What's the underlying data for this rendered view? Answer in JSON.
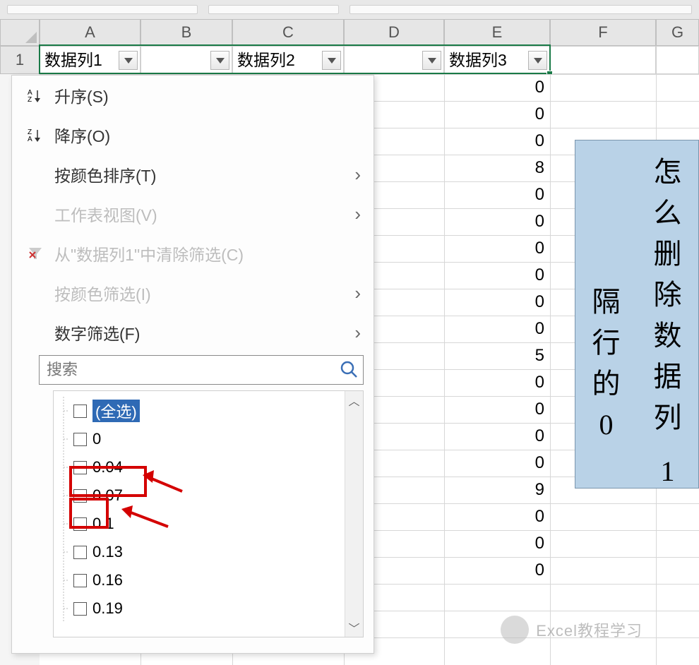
{
  "columns": {
    "A": "A",
    "B": "B",
    "C": "C",
    "D": "D",
    "E": "E",
    "F": "F",
    "G": "G"
  },
  "row1": "1",
  "headers": {
    "A": "数据列1",
    "C": "数据列2",
    "E": "数据列3"
  },
  "colE_values": [
    "0",
    "0",
    "0",
    "8",
    "0",
    "0",
    "0",
    "0",
    "0",
    "0",
    "5",
    "0",
    "0",
    "0",
    "0",
    "9",
    "0",
    "0",
    "0"
  ],
  "menu": {
    "sort_asc": "升序(S)",
    "sort_desc": "降序(O)",
    "sort_color": "按颜色排序(T)",
    "sheet_view": "工作表视图(V)",
    "clear_filter": "从\"数据列1\"中清除筛选(C)",
    "filter_color": "按颜色筛选(I)",
    "filter_number": "数字筛选(F)",
    "search_placeholder": "搜索",
    "items": [
      "(全选)",
      "0",
      "0.04",
      "0.07",
      "0.1",
      "0.13",
      "0.16",
      "0.19"
    ]
  },
  "tip": {
    "left": [
      "隔",
      "行",
      "的",
      "0"
    ],
    "right": [
      "怎",
      "么",
      "删",
      "除",
      "数",
      "据",
      "列",
      "1"
    ]
  },
  "watermark": "Excel教程学习"
}
